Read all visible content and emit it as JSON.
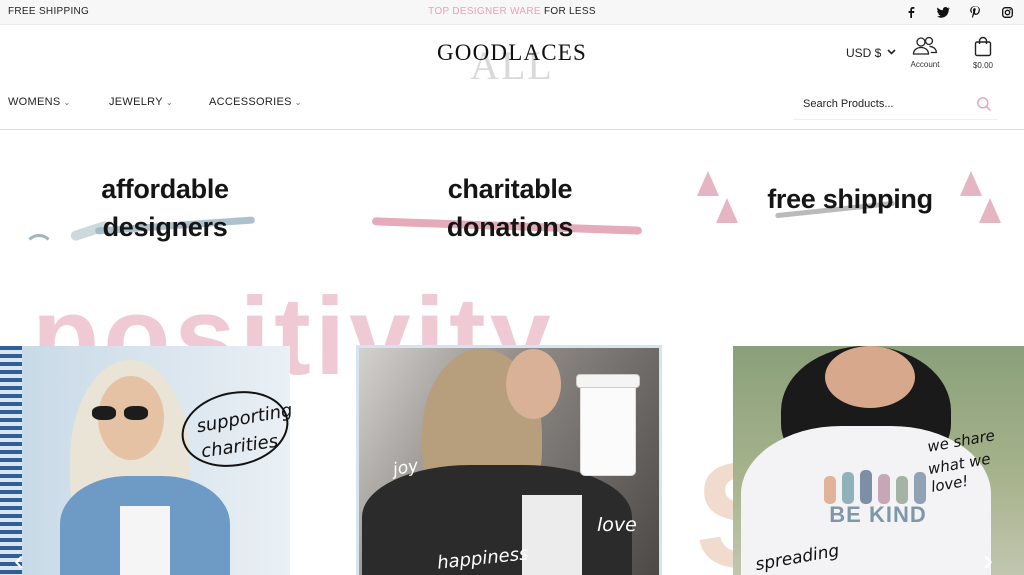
{
  "topbar": {
    "left_text": "FREE SHIPPING",
    "center_pink": "TOP DESIGNER WARE",
    "center_dark": " FOR LESS",
    "social": [
      "facebook-icon",
      "twitter-icon",
      "pinterest-icon",
      "instagram-icon"
    ]
  },
  "header": {
    "logo": "GOODLACES",
    "logo_watermark": "ALL",
    "currency": "USD $",
    "account_label": "Account",
    "cart_total": "$0.00"
  },
  "nav": {
    "items": [
      {
        "label": "WOMENS"
      },
      {
        "label": "JEWELRY"
      },
      {
        "label": "ACCESSORIES"
      }
    ]
  },
  "search": {
    "placeholder": "Search Products..."
  },
  "features": {
    "f1_line1": "affordable",
    "f1_line2": "designers",
    "f2_line1": "charitable",
    "f2_line2": "donations",
    "f3_line1": "free shipping"
  },
  "hero": {
    "big_word": "positivity",
    "card1_caption1": "supporting",
    "card1_caption2": "charities",
    "card2_caption_joy": "joy",
    "card2_caption_love": "love",
    "card2_caption_happiness": "happiness",
    "card3_caption1": "we share",
    "card3_caption2": "what we love!",
    "card3_caption3": "spreading",
    "tshirt_text": "BE KIND"
  },
  "colors": {
    "accent_pink": "#e7a3b4",
    "accent_blue": "#9cb6c2"
  }
}
